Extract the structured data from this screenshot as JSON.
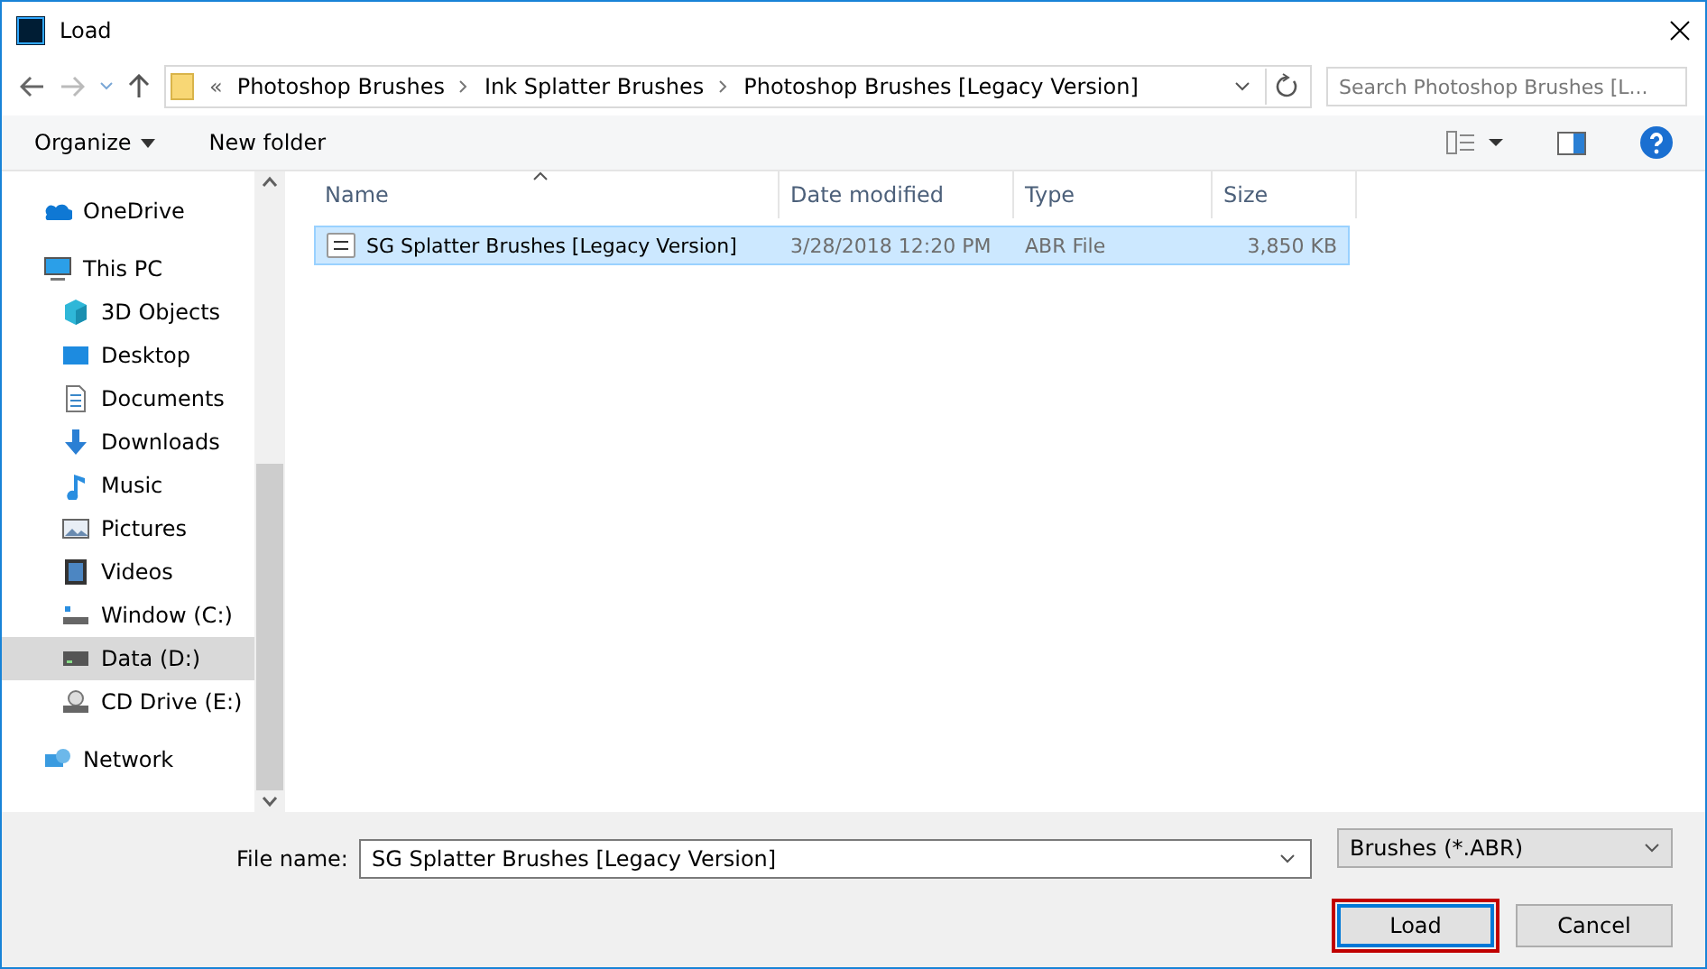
{
  "window": {
    "title": "Load"
  },
  "address": {
    "overflow": "«",
    "crumbs": [
      "Photoshop Brushes",
      "Ink Splatter Brushes",
      "Photoshop Brushes [Legacy Version]"
    ]
  },
  "search": {
    "placeholder": "Search Photoshop Brushes [L..."
  },
  "toolbar": {
    "organize": "Organize",
    "new_folder": "New folder"
  },
  "sidebar": {
    "items": [
      {
        "label": "OneDrive",
        "kind": "cloud",
        "selected": false
      },
      {
        "label": "This PC",
        "kind": "computer",
        "selected": false,
        "children": [
          {
            "label": "3D Objects",
            "kind": "cube",
            "selected": false
          },
          {
            "label": "Desktop",
            "kind": "desktop",
            "selected": false
          },
          {
            "label": "Documents",
            "kind": "document",
            "selected": false
          },
          {
            "label": "Downloads",
            "kind": "download",
            "selected": false
          },
          {
            "label": "Music",
            "kind": "music",
            "selected": false
          },
          {
            "label": "Pictures",
            "kind": "pictures",
            "selected": false
          },
          {
            "label": "Videos",
            "kind": "videos",
            "selected": false
          },
          {
            "label": "Window (C:)",
            "kind": "system-drive",
            "selected": false
          },
          {
            "label": "Data (D:)",
            "kind": "drive",
            "selected": true
          },
          {
            "label": "CD Drive (E:)",
            "kind": "cd",
            "selected": false
          }
        ]
      },
      {
        "label": "Network",
        "kind": "network",
        "selected": false
      }
    ]
  },
  "table": {
    "columns": [
      {
        "label": "Name",
        "sorted": true
      },
      {
        "label": "Date modified",
        "sorted": false
      },
      {
        "label": "Type",
        "sorted": false
      },
      {
        "label": "Size",
        "sorted": false
      }
    ],
    "rows": [
      {
        "name": "SG Splatter Brushes [Legacy Version]",
        "date": "3/28/2018 12:20 PM",
        "type": "ABR File",
        "size": "3,850 KB",
        "selected": true
      }
    ]
  },
  "footer": {
    "file_name_label": "File name:",
    "file_name": "SG Splatter Brushes [Legacy Version]",
    "filter": "Brushes (*.ABR)",
    "buttons": [
      {
        "label": "Load",
        "default": true
      },
      {
        "label": "Cancel",
        "default": false
      }
    ]
  }
}
